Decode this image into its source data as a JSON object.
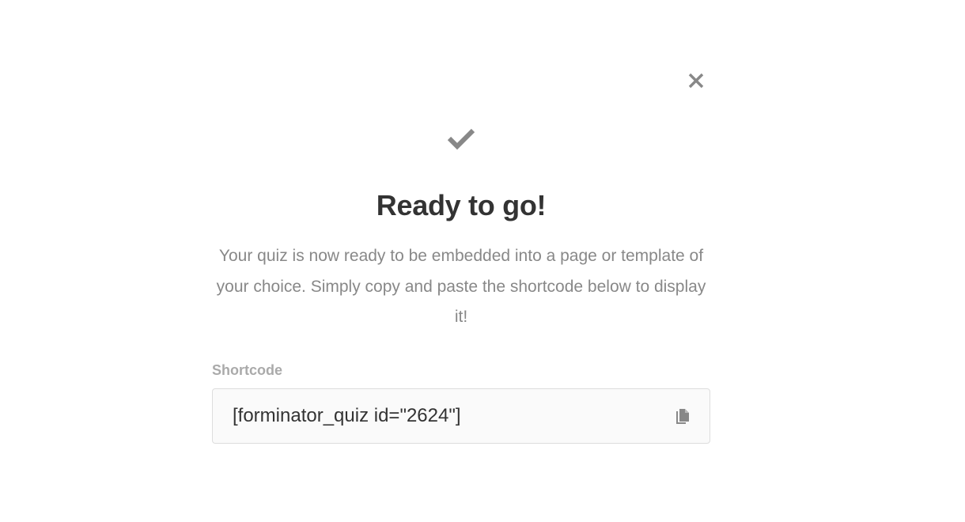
{
  "modal": {
    "close_icon": "close-icon",
    "status_icon": "checkmark-icon",
    "title": "Ready to go!",
    "description": "Your quiz is now ready to be embedded into a page or template of your choice. Simply copy and paste the shortcode below to display it!",
    "shortcode_label": "Shortcode",
    "shortcode_value": "[forminator_quiz id=\"2624\"]",
    "copy_icon": "copy-icon"
  },
  "colors": {
    "icon": "#888888",
    "title": "#333333",
    "text_muted": "#888888",
    "label": "#aaaaaa",
    "field_border": "#dddddd",
    "field_bg": "#fafafa"
  }
}
